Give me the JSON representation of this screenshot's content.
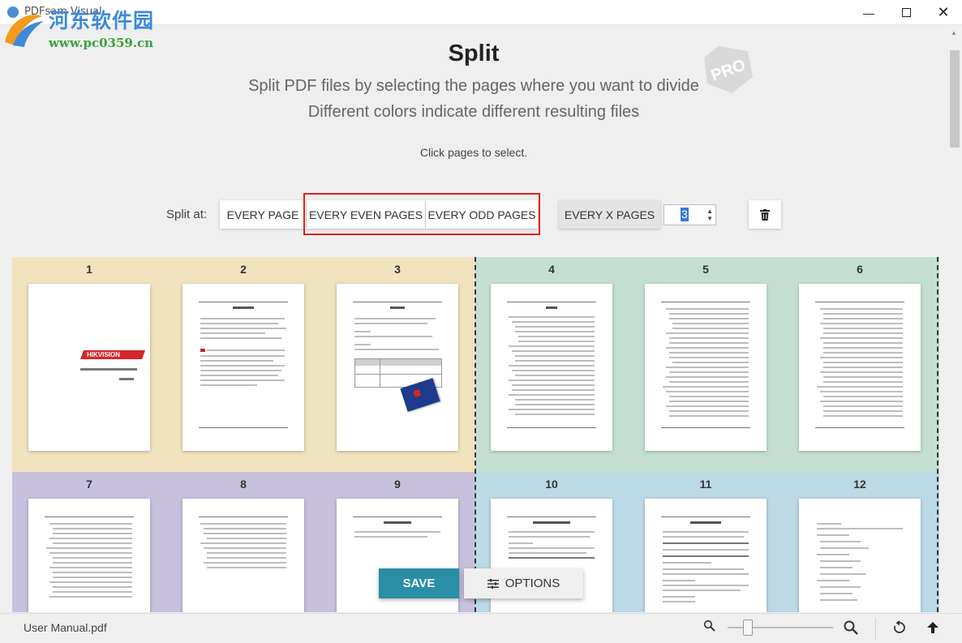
{
  "window": {
    "title": "PDFsam Visual",
    "watermark_name": "河东软件园",
    "watermark_url": "www.pc0359.cn"
  },
  "header": {
    "title": "Split",
    "subtitle_1": "Split PDF files by selecting the pages where you want to divide",
    "subtitle_2": "Different colors indicate different resulting files",
    "hint": "Click pages to select.",
    "badge": "PRO"
  },
  "toolbar": {
    "split_at_label": "Split at:",
    "every_page": "EVERY PAGE",
    "every_even": "EVERY EVEN PAGES",
    "every_odd": "EVERY ODD PAGES",
    "every_x": "EVERY X PAGES",
    "x_value": "3",
    "icons": {
      "delete": "trash-icon",
      "spin_up": "chevron-up-icon",
      "spin_down": "chevron-down-icon"
    }
  },
  "pages": {
    "numbers": [
      "1",
      "2",
      "3",
      "4",
      "5",
      "6",
      "7",
      "8",
      "9",
      "10",
      "11",
      "12"
    ],
    "cover_brand": "HIKVISION"
  },
  "group_colors": [
    "#f1e3bd",
    "#c4dfd2",
    "#c7c1de",
    "#bcd9e6"
  ],
  "actions": {
    "save": "SAVE",
    "options": "OPTIONS",
    "options_icon": "sliders-icon"
  },
  "footer": {
    "file_name": "User Manual.pdf",
    "icons": {
      "zoom_out": "zoom-out-icon",
      "zoom_in": "zoom-in-icon",
      "rotate": "rotate-icon",
      "move_up": "arrow-up-icon"
    }
  }
}
